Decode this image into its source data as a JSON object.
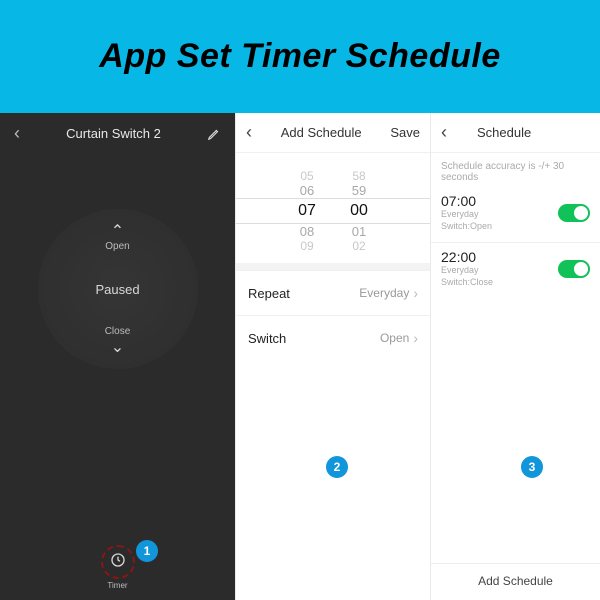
{
  "banner": {
    "title": "App Set Timer Schedule"
  },
  "colors": {
    "accent": "#1296db",
    "banner": "#07b8e7",
    "toggle_on": "#10c257"
  },
  "panel1": {
    "header": {
      "title": "Curtain Switch 2"
    },
    "dial": {
      "open_label": "Open",
      "close_label": "Close",
      "status": "Paused"
    },
    "timer": {
      "label": "Timer"
    },
    "badge": "1"
  },
  "panel2": {
    "header": {
      "title": "Add Schedule",
      "save": "Save"
    },
    "picker": {
      "hours": [
        "05",
        "06",
        "07",
        "08",
        "09"
      ],
      "minutes": [
        "58",
        "59",
        "00",
        "01",
        "02"
      ],
      "selected_hour": "07",
      "selected_minute": "00"
    },
    "rows": {
      "repeat": {
        "label": "Repeat",
        "value": "Everyday"
      },
      "switch": {
        "label": "Switch",
        "value": "Open"
      }
    },
    "badge": "2"
  },
  "panel3": {
    "header": {
      "title": "Schedule"
    },
    "accuracy_note": "Schedule accuracy is -/+ 30 seconds",
    "items": [
      {
        "time": "07:00",
        "repeat": "Everyday",
        "action": "Switch:Open",
        "on": true
      },
      {
        "time": "22:00",
        "repeat": "Everyday",
        "action": "Switch:Close",
        "on": true
      }
    ],
    "add_label": "Add Schedule",
    "badge": "3"
  }
}
